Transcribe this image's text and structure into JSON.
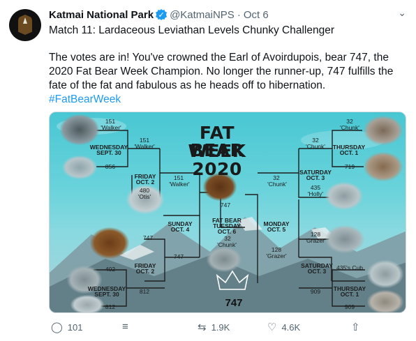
{
  "tweet": {
    "author_name": "Katmai National Park",
    "verified_mark": "✓",
    "handle": "@KatmaiNPS",
    "separator": "·",
    "date": "Oct 6",
    "subtitle": "Match 11: Lardaceous Leviathan Levels Chunky Challenger",
    "body_lines": [
      "The votes are in! You've crowned the Earl of Avoirdupois, bear 747, the",
      "2020 Fat Bear Week Champion. No longer the runner-up, 747 fulfills the",
      "fate of the fat and fabulous as he heads off to hibernation."
    ],
    "hashtag": "#FatBearWeek"
  },
  "bracket": {
    "title_lines": [
      "FAT BEAR",
      "WEEK",
      "2020"
    ],
    "labels": {
      "l1_top_num": "151",
      "l1_top_name": "'Walker'",
      "l1_wed": "WEDNESDAY",
      "l1_wed_date": "SEPT. 30",
      "l1_856": "856",
      "l2_151": "151",
      "l2_walker": "'Walker'",
      "l2_fri": "FRIDAY",
      "l2_fri_date": "OCT. 2",
      "l2_480": "480",
      "l2_otis": "'Otis'",
      "l3_151": "151",
      "l3_walker": "'Walker'",
      "l3_sun": "SUNDAY",
      "l3_sun_date": "OCT. 4",
      "l3_747a": "747",
      "l3_747b": "747",
      "l2b_747": "747",
      "l2b_fri": "FRIDAY",
      "l2b_fri_date": "OCT. 2",
      "l1b_402": "402",
      "l1b_wed": "WEDNESDAY",
      "l1b_wed_date": "SEPT. 30",
      "l1b_812a": "812",
      "l1b_812b": "812",
      "c_747": "747",
      "c_fbt": "FAT BEAR",
      "c_tues": "TUESDAY",
      "c_date": "OCT. 6",
      "c_32": "32",
      "c_chunk": "'Chunk'",
      "r3_32": "32",
      "r3_chunk": "'Chunk'",
      "r3_mon": "MONDAY",
      "r3_mon_date": "OCT. 5",
      "r3_128": "128",
      "r3_grazer": "'Grazer'",
      "r2_32": "32",
      "r2_chunk": "'Chunk'",
      "r2_sat": "SATURDAY",
      "r2_sat_date": "OCT. 3",
      "r2_435": "435",
      "r2_holly": "'Holly'",
      "r1_32": "32",
      "r1_chunk": "'Chunk'",
      "r1_thu": "THURSDAY",
      "r1_thu_date": "OCT. 1",
      "r1_719": "719",
      "r2b_128": "128",
      "r2b_grazer": "'Grazer'",
      "r2b_sat": "SATURDAY",
      "r2b_sat_date": "OCT. 3",
      "r2b_cub": "435's Cub",
      "r2b_909": "909",
      "r1b_thu": "THURSDAY",
      "r1b_thu_date": "OCT. 1",
      "r1b_909a": "909",
      "r1b_909b": "909"
    },
    "winner": "747"
  },
  "actions": {
    "reply_count": "101",
    "retweet_count": "1.9K",
    "like_count": "4.6K"
  },
  "icons": {
    "reply": "reply-icon",
    "share_stack": "stack-icon",
    "retweet": "retweet-icon",
    "like": "heart-icon",
    "upload": "upload-icon",
    "more": "chevron-down-icon"
  },
  "colors": {
    "accent": "#1d9bf0",
    "bracket_line": "#1e1e1e",
    "sky": "#48c7d3"
  }
}
